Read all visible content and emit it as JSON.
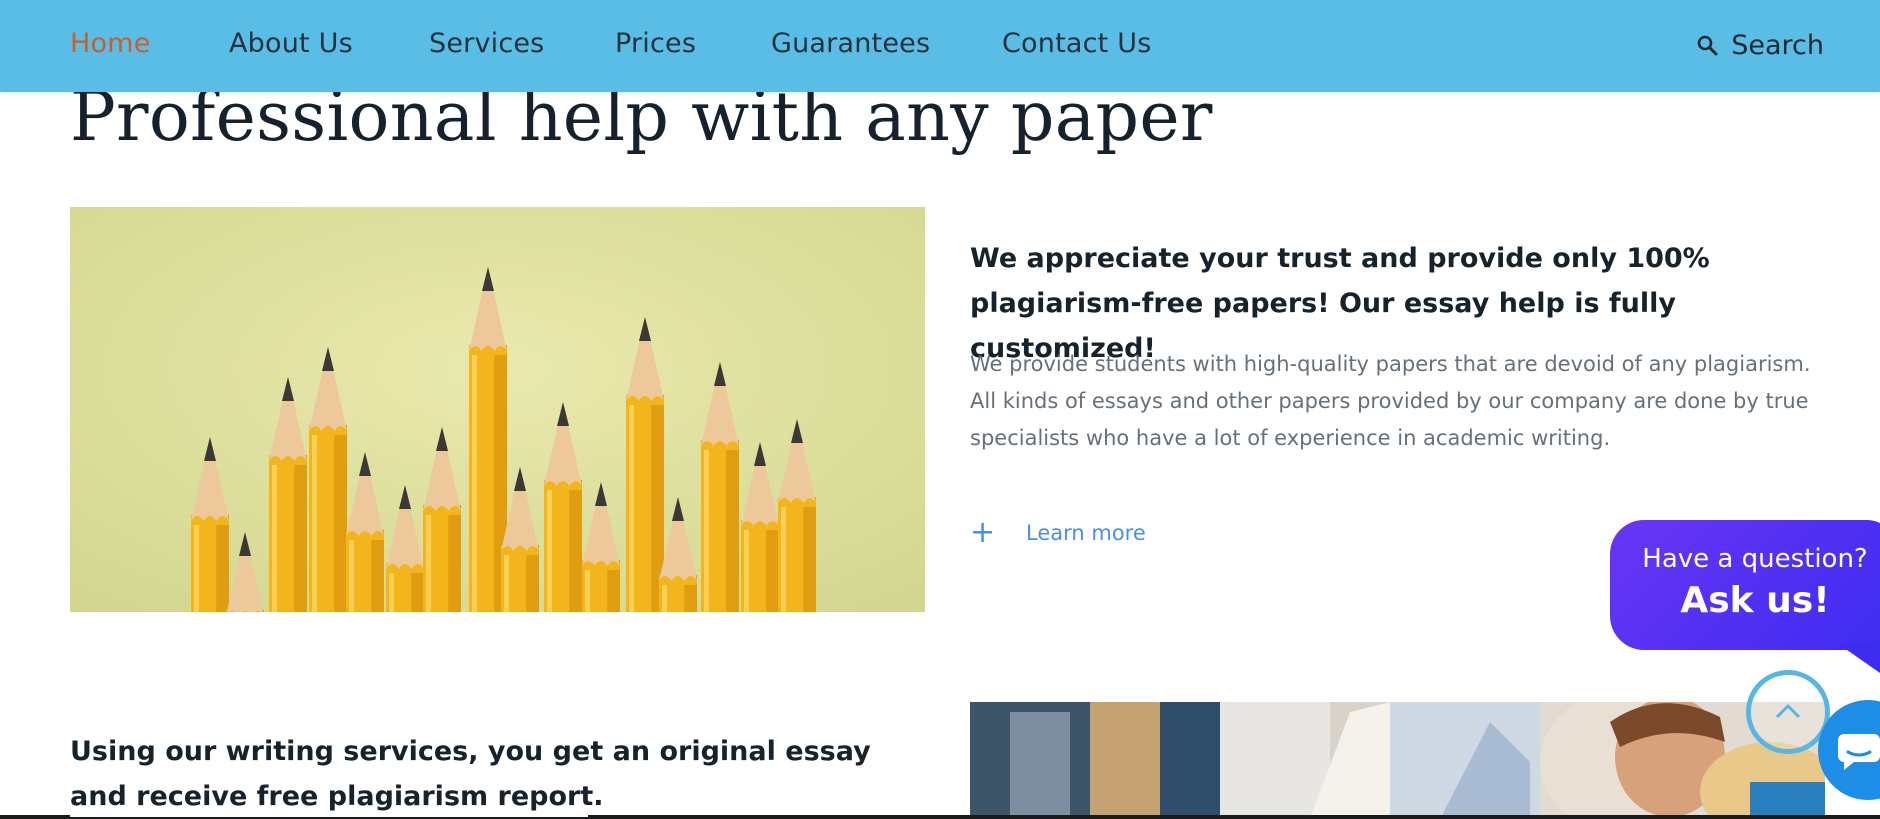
{
  "nav": {
    "items": [
      {
        "label": "Home",
        "active": true
      },
      {
        "label": "About Us"
      },
      {
        "label": "Services"
      },
      {
        "label": "Prices"
      },
      {
        "label": "Guarantees"
      },
      {
        "label": "Contact Us"
      }
    ],
    "search_label": "Search",
    "search_icon": "search-icon",
    "bg_color": "#59bde6",
    "active_color": "#c8602e"
  },
  "page": {
    "title": "Professional help with any paper"
  },
  "section1": {
    "heading": "We appreciate your trust and provide only 100% plagiarism-free papers! Our essay help is fully customized!",
    "text": "We provide students with high-quality papers that are devoid of any plagiarism. All kinds of essays and other papers provided by our company are done by true specialists who have a lot of experience in academic writing.",
    "learn_more": "Learn more",
    "learn_more_icon": "plus-icon"
  },
  "section2": {
    "heading": "Using our writing services, you get an original essay and receive free plagiarism report."
  },
  "chat": {
    "question": "Have a question?",
    "cta": "Ask us!",
    "bubble_color": "#5a32f4",
    "scroll_top_icon": "chevron-up-icon",
    "chat_icon": "chat-bubble-icon"
  }
}
